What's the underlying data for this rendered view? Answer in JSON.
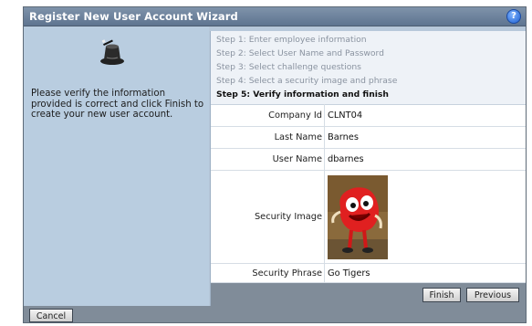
{
  "dialog": {
    "title": "Register New User Account Wizard",
    "help_icon": "?",
    "instructions": "Please verify the information provided is correct and click Finish to create your new user account."
  },
  "steps": [
    {
      "label": "Step 1: Enter employee information",
      "current": false
    },
    {
      "label": "Step 2: Select User Name and Password",
      "current": false
    },
    {
      "label": "Step 3: Select challenge questions",
      "current": false
    },
    {
      "label": "Step 4: Select a security image and phrase",
      "current": false
    },
    {
      "label": "Step 5: Verify information and finish",
      "current": true
    }
  ],
  "fields": {
    "company_id": {
      "label": "Company Id",
      "value": "CLNT04"
    },
    "last_name": {
      "label": "Last Name",
      "value": "Barnes"
    },
    "user_name": {
      "label": "User Name",
      "value": "dbarnes"
    },
    "security_image": {
      "label": "Security Image"
    },
    "security_phrase": {
      "label": "Security Phrase",
      "value": "Go Tigers"
    }
  },
  "buttons": {
    "finish": "Finish",
    "previous": "Previous",
    "cancel": "Cancel"
  },
  "icons": {
    "wizard": "magic-hat-icon",
    "help": "help-icon",
    "security_image": "red-mascot-image"
  },
  "colors": {
    "titlebar": "#6b7f98",
    "left_panel": "#b9cde0",
    "button_bar": "#808c99"
  }
}
